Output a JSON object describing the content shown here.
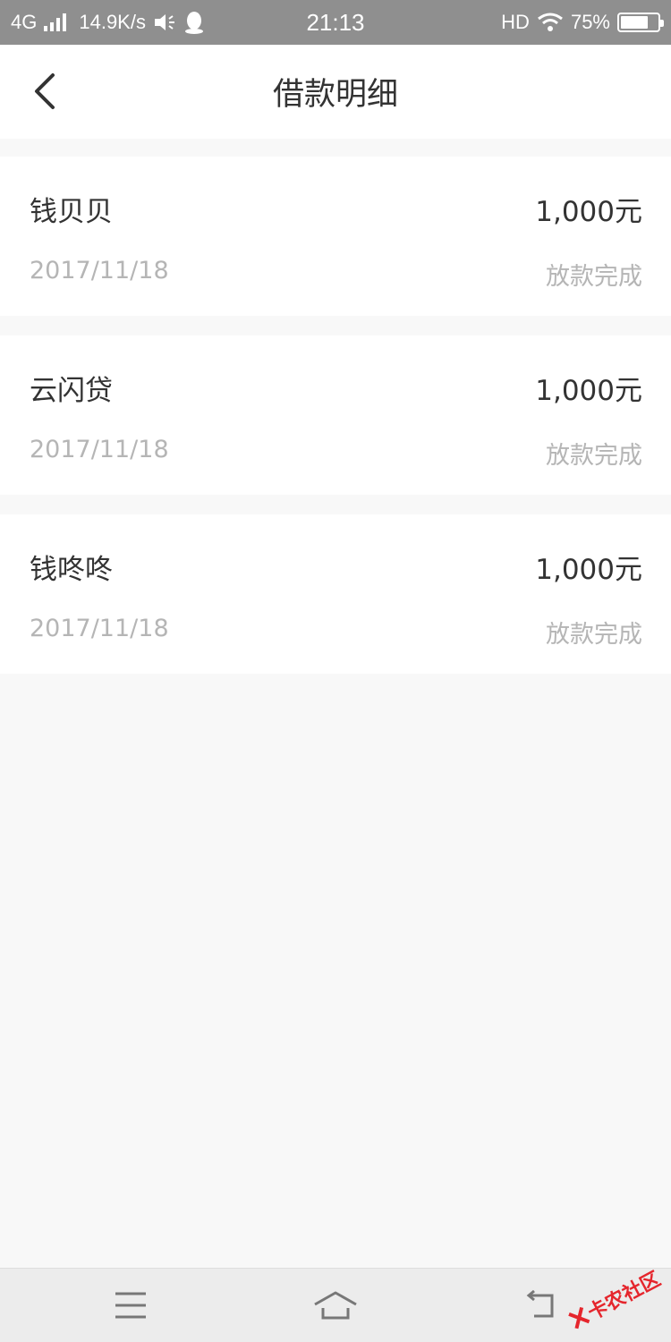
{
  "status_bar": {
    "network": "4G",
    "speed": "14.9K/s",
    "time": "21:13",
    "hd": "HD",
    "battery_text": "75%",
    "battery_level": 0.75
  },
  "header": {
    "title": "借款明细"
  },
  "loans": [
    {
      "name": "钱贝贝",
      "amount": "1,000元",
      "date": "2017/11/18",
      "status": "放款完成"
    },
    {
      "name": "云闪贷",
      "amount": "1,000元",
      "date": "2017/11/18",
      "status": "放款完成"
    },
    {
      "name": "钱咚咚",
      "amount": "1,000元",
      "date": "2017/11/18",
      "status": "放款完成"
    }
  ],
  "watermark": {
    "text": "卡农社区"
  },
  "colors": {
    "status_bar_bg": "#8f8f8f",
    "page_bg": "#f8f8f8",
    "primary_text": "#333333",
    "secondary_text": "#b5b5b5",
    "watermark": "#e5262d"
  },
  "icons": {
    "back": "chevron-left-icon",
    "menu": "menu-icon",
    "home": "home-icon",
    "return": "return-icon",
    "qq": "qq-penguin-icon",
    "speaker": "speaker-icon",
    "wifi": "wifi-icon"
  }
}
